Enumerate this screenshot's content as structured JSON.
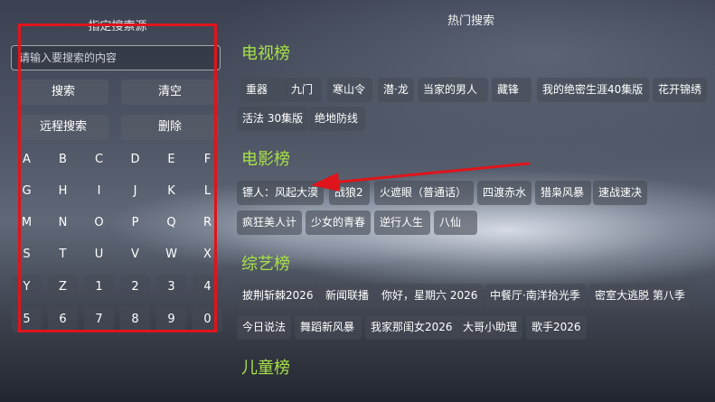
{
  "left": {
    "title": "指定搜索源",
    "search_placeholder": "请输入要搜索的内容",
    "search_button": "搜索",
    "clear_button": "清空",
    "remote_search_button": "远程搜索",
    "delete_button": "删除",
    "keys": [
      "A",
      "B",
      "C",
      "D",
      "E",
      "F",
      "G",
      "H",
      "I",
      "J",
      "K",
      "L",
      "M",
      "N",
      "O",
      "P",
      "Q",
      "R",
      "S",
      "T",
      "U",
      "V",
      "W",
      "X",
      "Y",
      "Z",
      "1",
      "2",
      "3",
      "4",
      "5",
      "6",
      "7",
      "8",
      "9",
      "0"
    ]
  },
  "right": {
    "title": "热门搜索",
    "sections": [
      {
        "title": "电视榜",
        "tags": [
          "重器",
          "九门",
          "寒山令",
          "潜·龙",
          "当家的男人",
          "藏锋",
          "我的绝密生涯40集版",
          "花开锦绣",
          "活法 30集版",
          "绝地防线"
        ]
      },
      {
        "title": "电影榜",
        "tags": [
          "镖人：风起大漠",
          "战狼2",
          "火遮眼（普通话）",
          "四渡赤水",
          "猎枭风暴",
          "速战速决",
          "疯狂美人计",
          "少女的青春",
          "逆行人生",
          "八仙"
        ]
      },
      {
        "title": "综艺榜",
        "tags": [
          "披荆斩棘2026",
          "新闻联播",
          "你好，星期六 2026",
          "中餐厅·南洋拾光季",
          "密室大逃脱 第八季",
          "今日说法",
          "舞蹈新风暴",
          "我家那闺女2026",
          "大哥小助理",
          "歌手2026"
        ]
      },
      {
        "title": "儿童榜",
        "tags": []
      }
    ]
  },
  "annotation": {
    "frame_color": "#e0141b",
    "arrow_color": "#e0141b"
  }
}
